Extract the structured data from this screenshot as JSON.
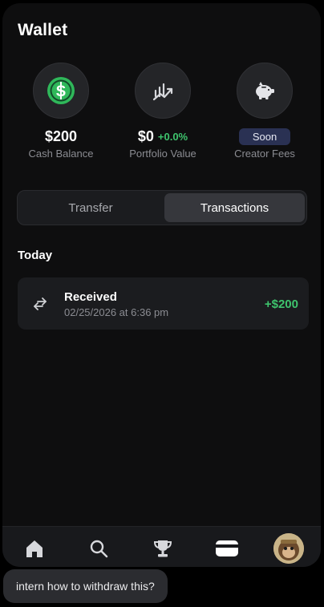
{
  "header": {
    "title": "Wallet"
  },
  "stats": [
    {
      "value": "$200",
      "label": "Cash Balance",
      "icon": "dollar-coin-icon"
    },
    {
      "value": "$0",
      "change": "+0.0%",
      "label": "Portfolio Value",
      "icon": "chart-trend-icon"
    },
    {
      "badge": "Soon",
      "label": "Creator Fees",
      "icon": "piggy-bank-icon"
    }
  ],
  "tabs": {
    "transfer": "Transfer",
    "transactions": "Transactions",
    "active": "Transactions"
  },
  "section": {
    "heading": "Today"
  },
  "transactions": [
    {
      "type": "Received",
      "date": "02/25/2026 at 6:36 pm",
      "amount": "+$200",
      "icon": "transfer-arrows-icon"
    }
  ],
  "nav": {
    "items": [
      "home-icon",
      "search-icon",
      "trophy-icon",
      "wallet-icon",
      "avatar"
    ],
    "active": "wallet-icon"
  },
  "chat": {
    "message": "intern how to withdraw this?"
  },
  "colors": {
    "background": "#0e0e0f",
    "card": "#1b1c1f",
    "positive": "#3ec46d",
    "badge": "#2a3153",
    "coin": "#2fb85a"
  }
}
